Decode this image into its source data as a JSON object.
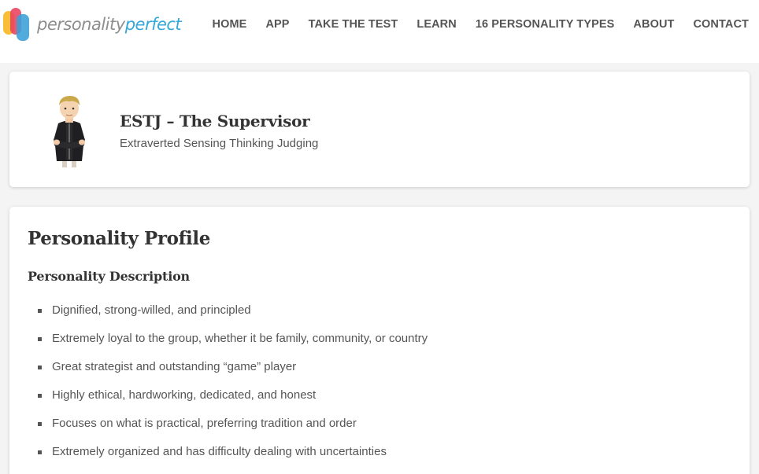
{
  "brand": {
    "name_part1": "personality",
    "name_part2": "perfect",
    "colors": {
      "yellow": "#f7b51c",
      "red": "#e8415e",
      "blue": "#3a9fd8",
      "text_gray": "#8e8e8e",
      "text_blue": "#34a8d8"
    }
  },
  "nav": {
    "items": [
      {
        "label": "HOME"
      },
      {
        "label": "APP"
      },
      {
        "label": "TAKE THE TEST"
      },
      {
        "label": "LEARN"
      },
      {
        "label": "16 PERSONALITY TYPES"
      },
      {
        "label": "ABOUT"
      },
      {
        "label": "CONTACT"
      }
    ]
  },
  "type_card": {
    "avatar_icon": "businessman-avatar-icon",
    "title": "ESTJ – The Supervisor",
    "subtitle": "Extraverted Sensing Thinking Judging"
  },
  "profile": {
    "heading": "Personality Profile",
    "subheading": "Personality Description",
    "traits": [
      "Dignified, strong-willed, and principled",
      "Extremely loyal to the group, whether it be family, community, or country",
      "Great strategist and outstanding “game” player",
      "Highly ethical, hardworking, dedicated, and honest",
      "Focuses on what is practical, preferring tradition and order",
      "Extremely organized and has difficulty dealing with uncertainties"
    ]
  }
}
